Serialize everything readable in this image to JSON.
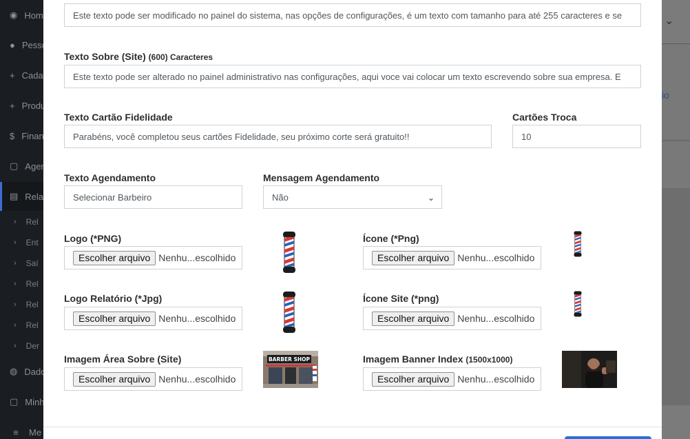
{
  "sidebar": {
    "items": [
      {
        "icon": "dashboard-icon",
        "glyph": "◉",
        "label": "Home"
      },
      {
        "icon": "users-icon",
        "glyph": "●",
        "label": "Pessoas"
      },
      {
        "icon": "plus-icon",
        "glyph": "+",
        "label": "Cadastros"
      },
      {
        "icon": "plus-icon",
        "glyph": "+",
        "label": "Produtos"
      },
      {
        "icon": "dollar-icon",
        "glyph": "$",
        "label": "Financeiro"
      },
      {
        "icon": "calendar-icon",
        "glyph": "▢",
        "label": "Agendamentos"
      },
      {
        "icon": "pdf-file-icon",
        "glyph": "▤",
        "label": "Relatórios"
      }
    ],
    "subitems": [
      "Rel",
      "Ent",
      "Saí",
      "Rel",
      "Rel",
      "Rel",
      "Der"
    ],
    "bottom_items": [
      {
        "icon": "globe-icon",
        "glyph": "◍",
        "label": "Dados"
      },
      {
        "icon": "calendar-icon",
        "glyph": "▢",
        "label": "Minha"
      },
      {
        "icon": "list-icon",
        "glyph": "≡",
        "label": "Me"
      }
    ]
  },
  "right_panel": {
    "text_fragment": "io"
  },
  "form": {
    "texto_sobre_index": {
      "value": "Este texto pode ser modificado no painel do sistema, nas opções de configurações, é um texto com tamanho para até 255 caracteres e se"
    },
    "texto_sobre_site": {
      "label": "Texto Sobre (Site)",
      "label_small": "(600) Caracteres",
      "value": "Este texto pode ser alterado no painel administrativo nas configurações, aqui voce vai colocar um texto escrevendo sobre sua empresa. E"
    },
    "texto_cartao": {
      "label": "Texto Cartão Fidelidade",
      "value": "Parabéns, você completou seus cartões Fidelidade, seu próximo corte será gratuito!!"
    },
    "cartoes_troca": {
      "label": "Cartões Troca",
      "value": "10"
    },
    "texto_agendamento": {
      "label": "Texto Agendamento",
      "value": "Selecionar Barbeiro"
    },
    "mensagem_agendamento": {
      "label": "Mensagem Agendamento",
      "value": "Não"
    },
    "file_button": "Escolher arquivo",
    "file_status": "Nenhu...escolhido",
    "logo": {
      "label": "Logo (*PNG)"
    },
    "icone": {
      "label": "Ícone (*Png)"
    },
    "logo_relatorio": {
      "label": "Logo Relatório (*Jpg)"
    },
    "icone_site": {
      "label": "Ícone Site (*png)"
    },
    "imagem_sobre": {
      "label": "Imagem Área Sobre (Site)",
      "sign_text": "BARBER SHOP"
    },
    "imagem_banner": {
      "label": "Imagem Banner Index",
      "label_small": "(1500x1000)"
    }
  },
  "colors": {
    "accent": "#2a6fdb",
    "sidebar_bg": "#1a1d21",
    "pole_red": "#d63a3a",
    "pole_blue": "#2d5fb8"
  }
}
